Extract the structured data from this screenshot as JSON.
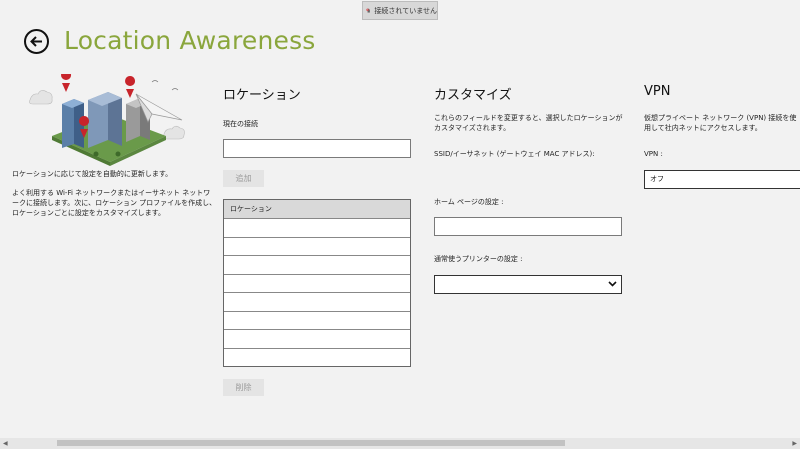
{
  "status_tip": {
    "text": "接続されていません",
    "icon": "no-network-icon"
  },
  "header": {
    "back_icon": "back-arrow-icon",
    "title": "Location Awareness",
    "title_color": "#8aa63c"
  },
  "intro": {
    "line1": "ロケーションに応じて設定を自動的に更新します。",
    "line2": "よく利用する Wi-Fi ネットワークまたはイーサネット ネットワークに接続します。次に、ロケーション プロファイルを作成し、ロケーションごとに設定をカスタマイズします。"
  },
  "location": {
    "heading": "ロケーション",
    "current_label": "現在の接続",
    "current_value": "",
    "add_label": "追加",
    "table_header": "ロケーション",
    "rows": [
      "",
      "",
      "",
      "",
      "",
      "",
      "",
      ""
    ],
    "delete_label": "削除"
  },
  "customize": {
    "heading": "カスタマイズ",
    "description": "これらのフィールドを変更すると、選択したロケーションがカスタマイズされます。",
    "ssid_label": "SSID/イーサネット (ゲートウェイ MAC アドレス):",
    "homepage_label": "ホーム ページの設定 :",
    "homepage_value": "",
    "printer_label": "通常使うプリンターの設定 :",
    "printer_value": ""
  },
  "vpn": {
    "heading": "VPN",
    "description": "仮想プライベート ネットワーク (VPN) 接続を使用して社内ネットにアクセスします。",
    "field_label": "VPN :",
    "field_value": "オフ"
  }
}
